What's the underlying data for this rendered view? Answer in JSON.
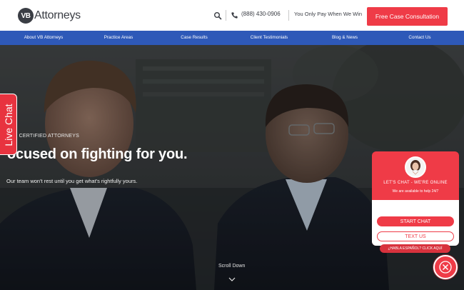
{
  "header": {
    "logo_mark": "VB",
    "logo_text": "Attorneys",
    "search_icon": "search-icon",
    "phone_icon": "phone-icon",
    "phone": "(888) 430-0906",
    "tagline": "You Only Pay When We Win",
    "cta_label": "Free Case Consultation"
  },
  "nav": {
    "items": [
      {
        "label": "About VB Attorneys"
      },
      {
        "label": "Practice Areas"
      },
      {
        "label": "Case Results"
      },
      {
        "label": "Client Testimonials"
      },
      {
        "label": "Blog & News"
      },
      {
        "label": "Contact Us"
      }
    ]
  },
  "hero": {
    "subtitle": "RD CERTIFIED ATTORNEYS",
    "title": "ocused on fighting for you.",
    "description": "Our team won't rest until you get what's rightfully yours.",
    "scroll_label": "Scroll Down",
    "scroll_icon": "chevron-down-icon"
  },
  "live_chat_tab": {
    "label": "Live Chat"
  },
  "chat_widget": {
    "online_label": "LET'S CHAT - WE'RE ONLINE",
    "available_label": "We are available to help 24/7",
    "start_chat_label": "START CHAT",
    "text_us_label": "TEXT US",
    "espanol_label": "¿HABLA ESPAÑOL? CLICK AQUÍ",
    "close_icon": "close-icon",
    "avatar_icon": "agent-avatar"
  },
  "colors": {
    "brand_red": "#ef3b47",
    "nav_blue": "#2e59b8",
    "text_dark": "#3a3d44"
  }
}
